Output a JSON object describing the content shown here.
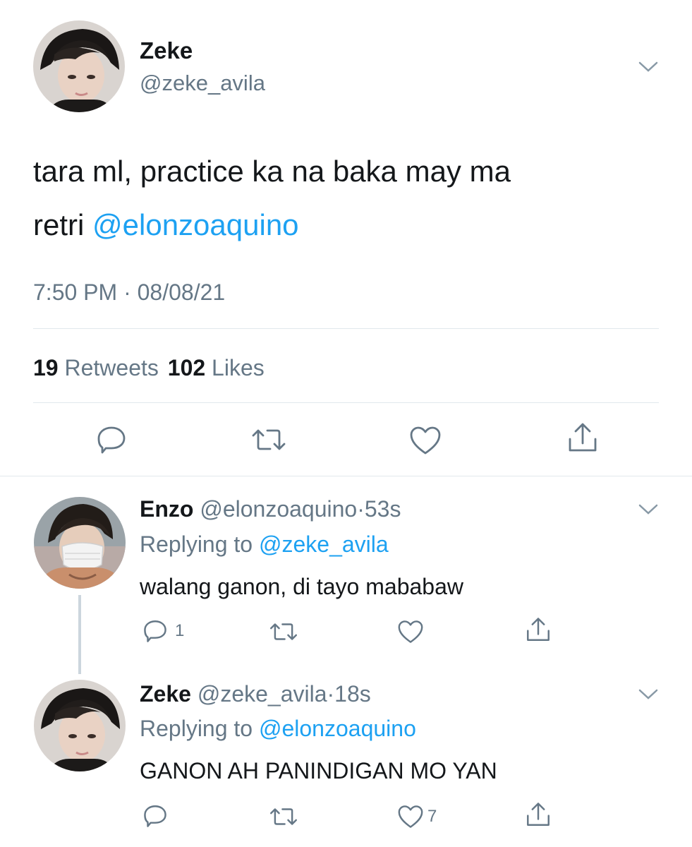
{
  "main_tweet": {
    "display_name": "Zeke",
    "handle": "@zeke_avila",
    "text_part1": "tara ml, practice ka na baka may ma",
    "text_part2": "retri",
    "mention": "@elonzoaquino",
    "timestamp": "7:50 PM · 08/08/21",
    "retweets_count": "19",
    "retweets_label": "Retweets",
    "likes_count": "102",
    "likes_label": "Likes"
  },
  "replies": [
    {
      "display_name": "Enzo",
      "handle": "@elonzoaquino",
      "time": "53s",
      "replying_to_label": "Replying to",
      "replying_to_handle": "@zeke_avila",
      "text": "walang ganon, di tayo mababaw",
      "reply_count": "1",
      "like_count": ""
    },
    {
      "display_name": "Zeke",
      "handle": "@zeke_avila",
      "time": "18s",
      "replying_to_label": "Replying to",
      "replying_to_handle": "@elonzoaquino",
      "text": "GANON AH PANINDIGAN MO YAN",
      "reply_count": "",
      "like_count": "7"
    }
  ],
  "colors": {
    "text": "#14171a",
    "secondary": "#657786",
    "link": "#1da1f2",
    "divider": "#e1e8ed",
    "thread_line": "#ccd6dd"
  },
  "icons": [
    "chevron-down-icon",
    "reply-icon",
    "retweet-icon",
    "like-icon",
    "share-icon"
  ]
}
